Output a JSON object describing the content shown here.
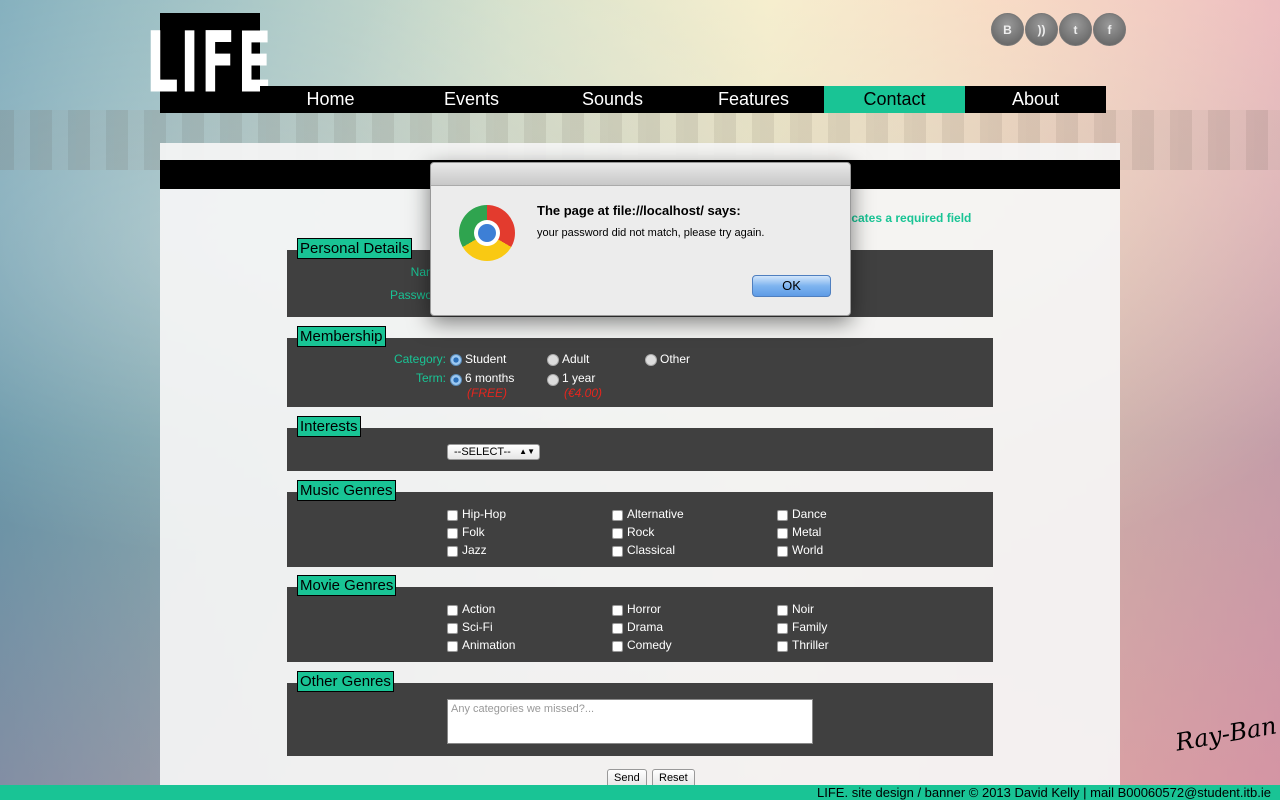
{
  "logo": {
    "text": "LIFE"
  },
  "social": [
    "blogger-icon",
    "rss-icon",
    "twitter-icon",
    "facebook-icon"
  ],
  "nav": {
    "items": [
      "Home",
      "Events",
      "Sounds",
      "Features",
      "Contact",
      "About"
    ],
    "active": "Contact"
  },
  "form": {
    "required_note": "indicates a required field",
    "personal": {
      "legend": "Personal Details",
      "name_label": "Name:",
      "password_label": "Password:"
    },
    "membership": {
      "legend": "Membership",
      "category_label": "Category:",
      "categories": [
        "Student",
        "Adult",
        "Other"
      ],
      "term_label": "Term:",
      "terms": [
        "6 months",
        "1 year"
      ],
      "prices": [
        "(FREE)",
        "(€4.00)"
      ]
    },
    "interests": {
      "legend": "Interests",
      "select_value": "--SELECT--"
    },
    "music": {
      "legend": "Music Genres",
      "options": [
        "Hip-Hop",
        "Alternative",
        "Dance",
        "Folk",
        "Rock",
        "Metal",
        "Jazz",
        "Classical",
        "World"
      ]
    },
    "movie": {
      "legend": "Movie Genres",
      "options": [
        "Action",
        "Horror",
        "Noir",
        "Sci-Fi",
        "Drama",
        "Family",
        "Animation",
        "Comedy",
        "Thriller"
      ]
    },
    "other": {
      "legend": "Other Genres",
      "placeholder": "Any categories we missed?..."
    },
    "send_label": "Send",
    "reset_label": "Reset"
  },
  "footer": {
    "text": "LIFE. site design / banner © 2013 David Kelly | mail B00060572@student.itb.ie"
  },
  "brand": {
    "text": "Ray-Ban"
  },
  "dialog": {
    "title": "The page at file://localhost/ says:",
    "message": "your password did not match, please try again.",
    "ok_label": "OK"
  },
  "colors": {
    "accent": "#19c495",
    "nav_bg": "#000000",
    "fieldset_bg": "#404040",
    "price": "#e4251e"
  }
}
